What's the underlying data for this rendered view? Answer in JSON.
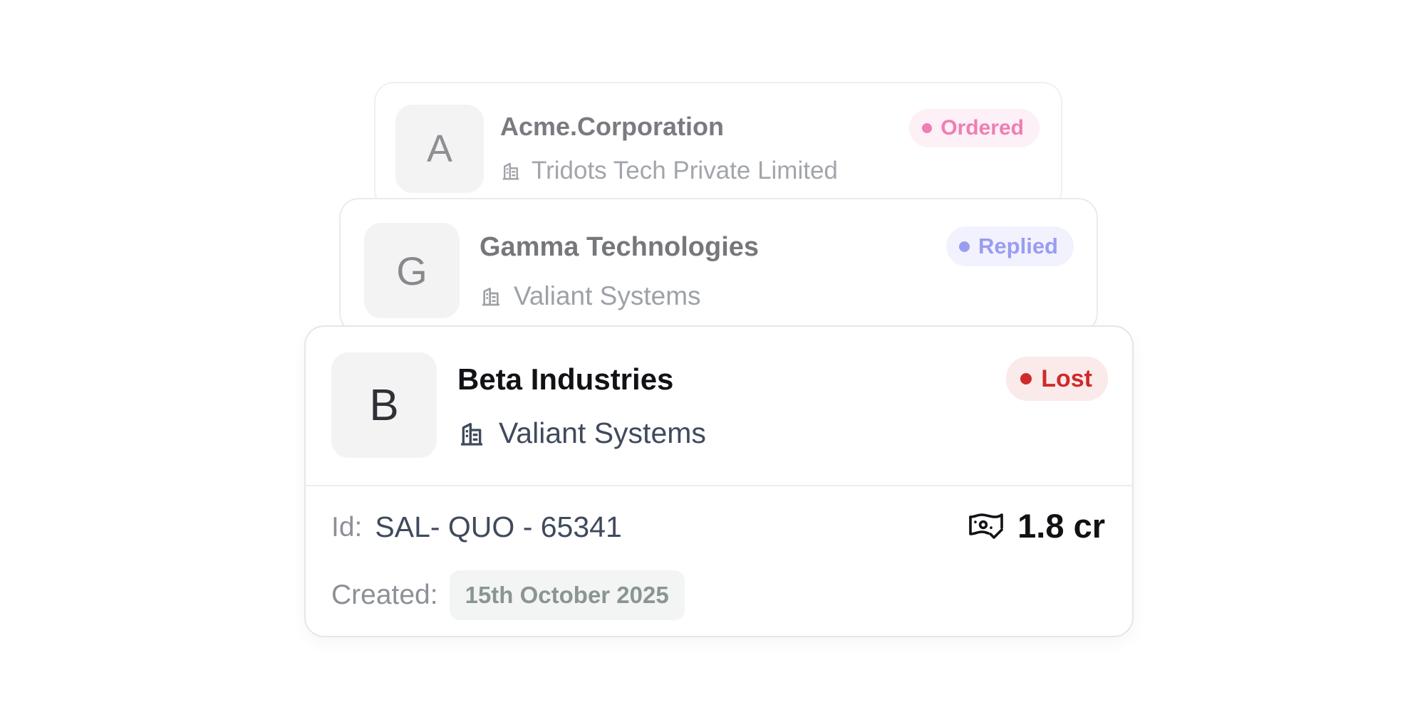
{
  "cards": [
    {
      "avatar_letter": "A",
      "name": "Acme.Corporation",
      "company": "Tridots Tech Private Limited",
      "company_icon": "building-icon",
      "status": "Ordered",
      "status_color": "#ef7eb4"
    },
    {
      "avatar_letter": "G",
      "name": "Gamma Technologies",
      "company": "Valiant Systems",
      "company_icon": "building-icon",
      "status": "Replied",
      "status_color": "#9a9cf2"
    },
    {
      "avatar_letter": "B",
      "name": "Beta Industries",
      "company": "Valiant Systems",
      "company_icon": "building-icon",
      "status": "Lost",
      "status_color": "#cf2a2a",
      "details": {
        "id_label": "Id:",
        "id_value": "SAL- QUO - 65341",
        "amount_icon": "money-check-icon",
        "amount": "1.8 cr",
        "created_label": "Created:",
        "created_date": "15th October 2025"
      }
    }
  ]
}
